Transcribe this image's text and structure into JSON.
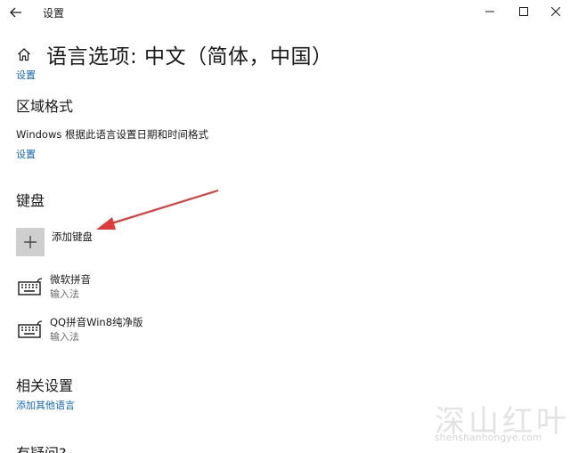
{
  "window": {
    "app_title": "设置",
    "back_icon": "back-arrow-icon",
    "controls": [
      "minimize-icon",
      "maximize-icon",
      "close-icon"
    ]
  },
  "header": {
    "title": "语言选项: 中文（简体，中国）",
    "settings_link": "设置"
  },
  "region_format": {
    "title": "区域格式",
    "description": "Windows 根据此语言设置日期和时间格式",
    "settings_link": "设置"
  },
  "keyboard": {
    "title": "键盘",
    "add_label": "添加键盘",
    "items": [
      {
        "name": "微软拼音",
        "sub": "输入法"
      },
      {
        "name": "QQ拼音Win8纯净版",
        "sub": "输入法"
      }
    ]
  },
  "related": {
    "title": "相关设置",
    "link": "添加其他语言"
  },
  "cut_section_title": "有疑问?",
  "watermark": {
    "main": "深山红叶",
    "sub": "shenshanhongye.com"
  },
  "colors": {
    "link": "#1368c4",
    "annotation_arrow": "#e03a3a",
    "add_button_bg": "#cfcfcf"
  }
}
